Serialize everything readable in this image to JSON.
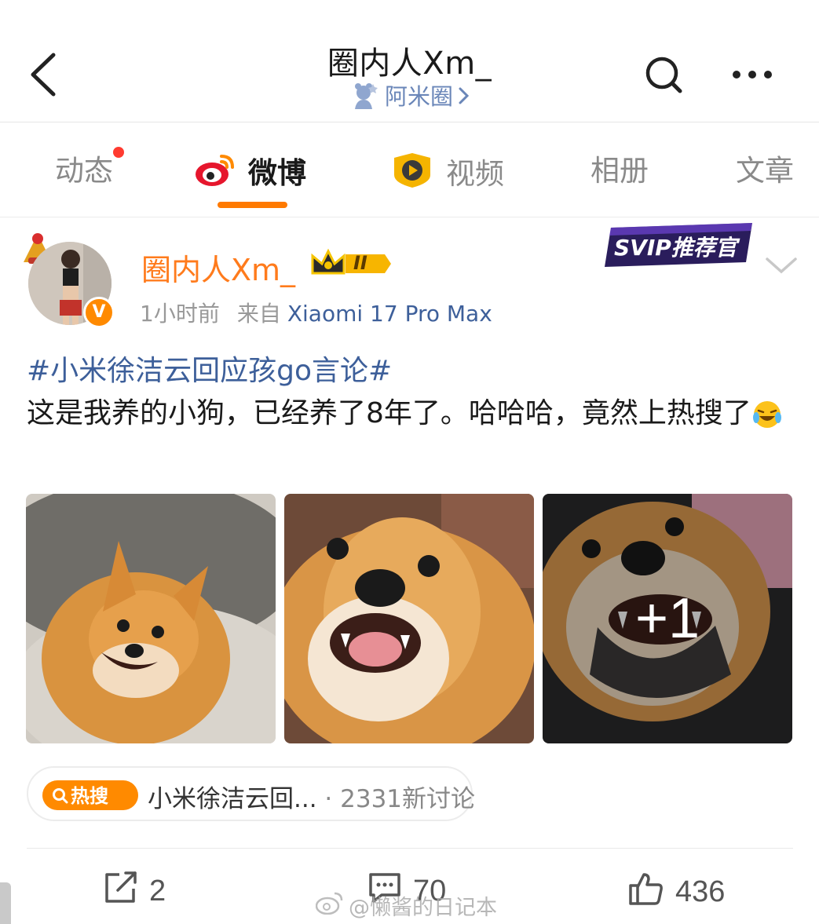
{
  "header": {
    "title": "圈内人Xm_",
    "subtitle": "阿米圈",
    "icons": {
      "back": "back-chevron-icon",
      "search": "search-icon",
      "more": "more-dots-icon"
    }
  },
  "tabs": [
    {
      "label": "动态",
      "has_dot": true
    },
    {
      "label": "微博",
      "active": true,
      "icon": "weibo-logo-icon"
    },
    {
      "label": "视频",
      "icon": "video-play-icon"
    },
    {
      "label": "相册"
    },
    {
      "label": "文章"
    }
  ],
  "post": {
    "username": "圈内人Xm_",
    "verified_badge": "V",
    "member_level": "II",
    "svip_badge": "SVIP推荐官",
    "time": "1小时前",
    "source_prefix": "来自",
    "source_device": "Xiaomi 17 Pro Max",
    "hashtag": "#小米徐洁云回应孩go言论#",
    "text": "这是我养的小狗，已经养了8年了。哈哈哈，竟然上热搜了",
    "emoji": "laughing-tears-emoji",
    "photos": [
      "shiba-photo-1",
      "shiba-photo-2",
      "shiba-photo-3"
    ],
    "more_photos": "+1",
    "hot_search": {
      "tag": "热搜",
      "title": "小米徐洁云回...",
      "separator": "·",
      "count": "2331新讨论"
    },
    "actions": {
      "repost": "2",
      "comment": "70",
      "like": "436"
    }
  },
  "watermark": "@懒酱的日记本",
  "colors": {
    "accent_orange": "#ff7a00",
    "username_orange": "#ff7b1c",
    "link_blue": "#3d5f9a",
    "notify_red": "#ff3b30"
  }
}
